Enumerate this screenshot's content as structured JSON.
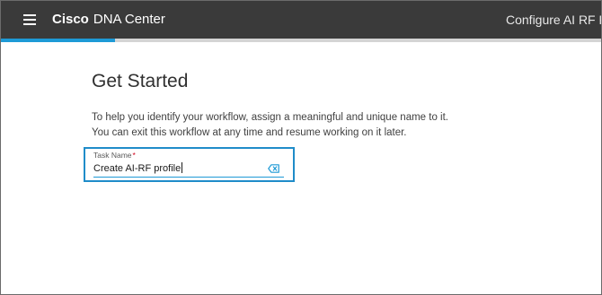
{
  "header": {
    "brand_bold": "Cisco",
    "brand_rest": "DNA Center",
    "right_title": "Configure AI RF P"
  },
  "progress": {
    "fraction": 0.19,
    "color": "#1e9ad6"
  },
  "main": {
    "title": "Get Started",
    "description_lines": [
      "To help you identify your workflow, assign a meaningful and unique name to it.",
      "You can exit this workflow at any time and resume working on it later."
    ],
    "task_field": {
      "label": "Task Name",
      "required_marker": "*",
      "value": "Create AI-RF profile",
      "clear_icon": "clear-backspace-icon"
    }
  },
  "colors": {
    "header_bg": "#3a3a3a",
    "accent": "#1e9ad6",
    "required": "#d0021b"
  }
}
